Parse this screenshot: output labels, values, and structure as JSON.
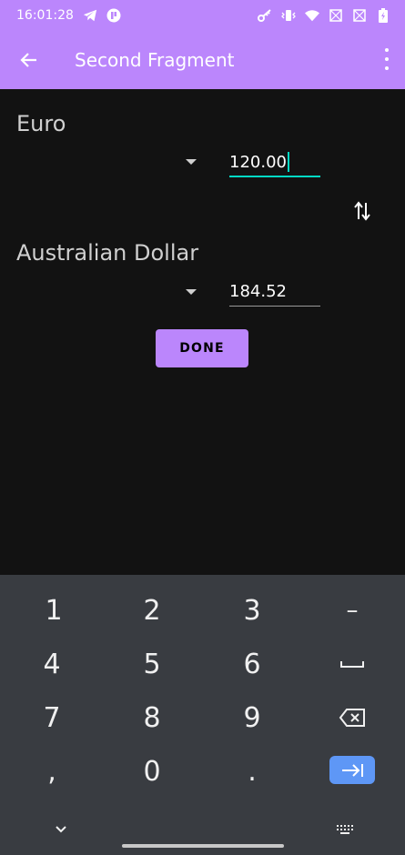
{
  "status_bar": {
    "time": "16:01:28",
    "icons": [
      "telegram-icon",
      "app-notification-icon",
      "vpn-key-icon",
      "vibrate-icon",
      "wifi-icon",
      "no-signal-icon",
      "no-signal-icon",
      "battery-charging-icon"
    ]
  },
  "app_bar": {
    "title": "Second Fragment",
    "color": "#bb86fc"
  },
  "from_currency": {
    "label": "Euro",
    "amount": "120.00"
  },
  "to_currency": {
    "label": "Australian Dollar",
    "amount": "184.52"
  },
  "done_button": {
    "label": "DONE"
  },
  "accent_color": "#03dac5",
  "keyboard": {
    "rows": [
      [
        "1",
        "2",
        "3",
        "–"
      ],
      [
        "4",
        "5",
        "6",
        "␣"
      ],
      [
        "7",
        "8",
        "9",
        "backspace"
      ],
      [
        ",",
        "0",
        ".",
        "tab"
      ]
    ]
  }
}
